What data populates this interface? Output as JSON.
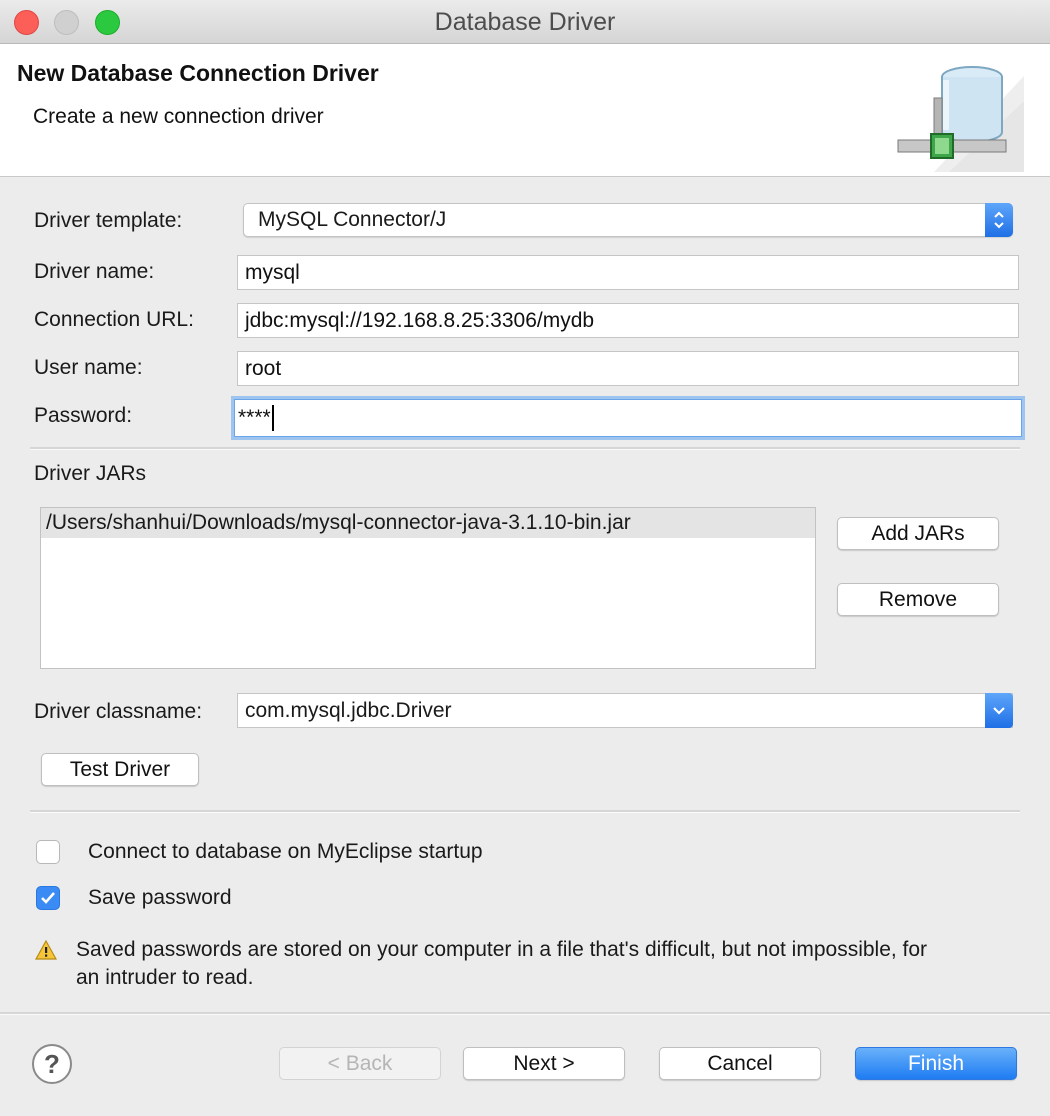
{
  "window": {
    "title": "Database Driver"
  },
  "header": {
    "title": "New Database Connection Driver",
    "subtitle": "Create a new connection driver",
    "icon": "database-connection-icon"
  },
  "form": {
    "driver_template_label": "Driver template:",
    "driver_template_value": "MySQL Connector/J",
    "driver_name_label": "Driver name:",
    "driver_name_value": "mysql",
    "connection_url_label": "Connection URL:",
    "connection_url_value": "jdbc:mysql://192.168.8.25:3306/mydb",
    "user_name_label": "User name:",
    "user_name_value": "root",
    "password_label": "Password:",
    "password_value": "****"
  },
  "jars": {
    "section_label": "Driver JARs",
    "items": [
      "/Users/shanhui/Downloads/mysql-connector-java-3.1.10-bin.jar"
    ],
    "add_label": "Add JARs",
    "remove_label": "Remove"
  },
  "classname": {
    "label": "Driver classname:",
    "value": "com.mysql.jdbc.Driver"
  },
  "test_driver_label": "Test Driver",
  "options": {
    "connect_startup_label": "Connect to database on MyEclipse startup",
    "connect_startup_checked": false,
    "save_password_label": "Save password",
    "save_password_checked": true
  },
  "warning": {
    "icon": "warning-icon",
    "text": "Saved passwords are stored on your computer in a file that's difficult, but not impossible, for an intruder to read."
  },
  "footer": {
    "back_label": "< Back",
    "next_label": "Next >",
    "cancel_label": "Cancel",
    "finish_label": "Finish",
    "help_symbol": "?"
  },
  "colors": {
    "accent": "#1e7cf2",
    "focus_ring": "#9ec4f0",
    "close": "#fc5f57",
    "maximize": "#2ac940"
  }
}
